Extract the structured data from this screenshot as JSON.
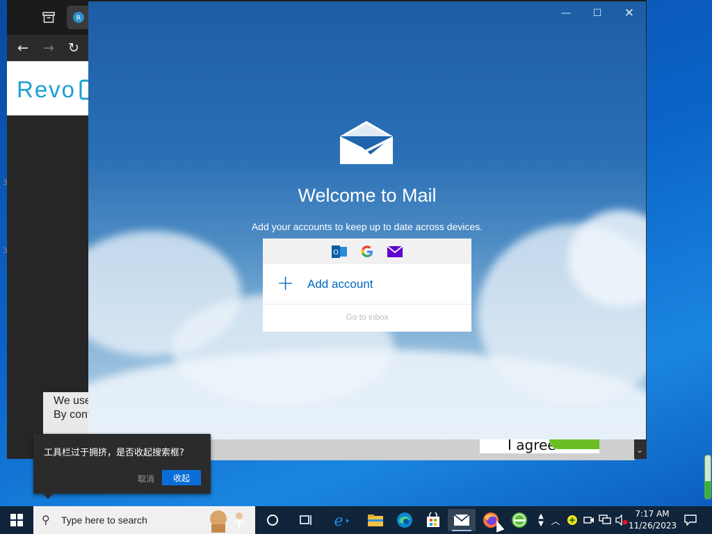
{
  "browser": {
    "tab_icons": [
      "archive-icon",
      "revo-tab-icon"
    ],
    "nav": [
      "back-arrow-icon",
      "forward-arrow-icon",
      "reload-icon"
    ],
    "banner_text": "Revo",
    "cookie_lines": [
      "We use",
      "By cont"
    ],
    "cookie_strip_text": "...",
    "agree_text": "I agree"
  },
  "mail": {
    "controls": [
      "minimize-icon",
      "maximize-icon",
      "close-icon"
    ],
    "title": "Welcome to Mail",
    "subtitle": "Add your accounts to keep up to date across devices.",
    "providers": [
      "outlook-icon",
      "google-icon",
      "yahoo-mail-icon"
    ],
    "add_account": "Add account",
    "go_to_inbox": "Go to inbox",
    "accent": "#0067c0"
  },
  "tooltip": {
    "message": "工具栏过于拥挤，是否收起搜索框?",
    "cancel": "取消",
    "confirm": "收起"
  },
  "volume": {
    "level": 0.4
  },
  "taskbar": {
    "search_placeholder": "Type here to search",
    "apps": [
      "cortana-icon",
      "task-view-icon",
      "internet-explorer-icon",
      "file-explorer-icon",
      "edge-icon",
      "store-icon",
      "mail-icon",
      "firefox-icon",
      "green-app-icon"
    ],
    "clock_time": "7:17 AM",
    "clock_date": "11/26/2023"
  }
}
